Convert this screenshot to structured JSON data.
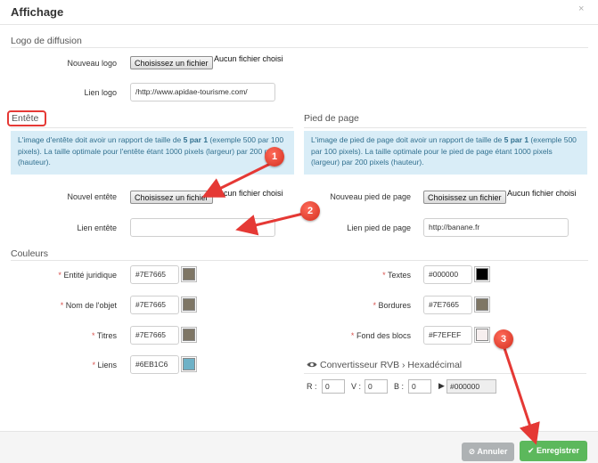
{
  "dialog": {
    "title": "Affichage",
    "close_glyph": "×"
  },
  "logo": {
    "section_title": "Logo de diffusion",
    "new_logo_label": "Nouveau logo",
    "file_button": "Choisissez un fichier",
    "no_file": "Aucun fichier choisi",
    "logo_link_label": "Lien logo",
    "logo_link_value": "/http://www.apidae-tourisme.com/"
  },
  "header": {
    "section_title": "Entête",
    "info_text_1": "L'image d'entête doit avoir un rapport de taille de ",
    "info_ratio": "5 par 1",
    "info_text_2": " (exemple 500 par 100 pixels). La taille optimale pour l'entête étant 1000 pixels (largeur) par 200 pixels (hauteur).",
    "new_header_label": "Nouvel entête",
    "file_button": "Choisissez un fichier",
    "no_file": "Aucun fichier choisi",
    "header_link_label": "Lien entête",
    "header_link_value": ""
  },
  "footer_section": {
    "section_title": "Pied de page",
    "info_text_1": "L'image de pied de page doit avoir un rapport de taille de ",
    "info_ratio": "5 par 1",
    "info_text_2": " (exemple 500 par 100 pixels). La taille optimale pour le pied de page étant 1000 pixels (largeur) par 200 pixels (hauteur).",
    "new_footer_label": "Nouveau pied de page",
    "file_button": "Choisissez un fichier",
    "no_file": "Aucun fichier choisi",
    "footer_link_label": "Lien pied de page",
    "footer_link_value": "http://banane.fr"
  },
  "colors": {
    "section_title": "Couleurs",
    "required_mark": "*",
    "left": [
      {
        "label": "Entité juridique",
        "value": "#7E7665",
        "swatch": "#7E7665"
      },
      {
        "label": "Nom de l'objet",
        "value": "#7E7665",
        "swatch": "#7E7665"
      },
      {
        "label": "Titres",
        "value": "#7E7665",
        "swatch": "#7E7665"
      },
      {
        "label": "Liens",
        "value": "#6EB1C6",
        "swatch": "#6EB1C6"
      }
    ],
    "right": [
      {
        "label": "Textes",
        "value": "#000000",
        "swatch": "#000000"
      },
      {
        "label": "Bordures",
        "value": "#7E7665",
        "swatch": "#7E7665"
      },
      {
        "label": "Fond des blocs",
        "value": "#F7EFEF",
        "swatch": "#F7EFEF"
      }
    ]
  },
  "converter": {
    "icon": "eye-icon",
    "title": "Convertisseur RVB › Hexadécimal",
    "r_label": "R :",
    "r_value": "0",
    "v_label": "V :",
    "v_value": "0",
    "b_label": "B :",
    "b_value": "0",
    "arrow_glyph": "▶",
    "result": "#000000"
  },
  "actions": {
    "cancel_label": "Annuler",
    "cancel_icon": "⊘",
    "save_label": "Enregistrer",
    "save_icon": "✔"
  },
  "annotations": {
    "badge1": "1",
    "badge2": "2",
    "badge3": "3"
  },
  "theme": {
    "accent_green": "#5cb85c",
    "info_bg": "#d9edf7",
    "annotation_red": "#e53935"
  }
}
